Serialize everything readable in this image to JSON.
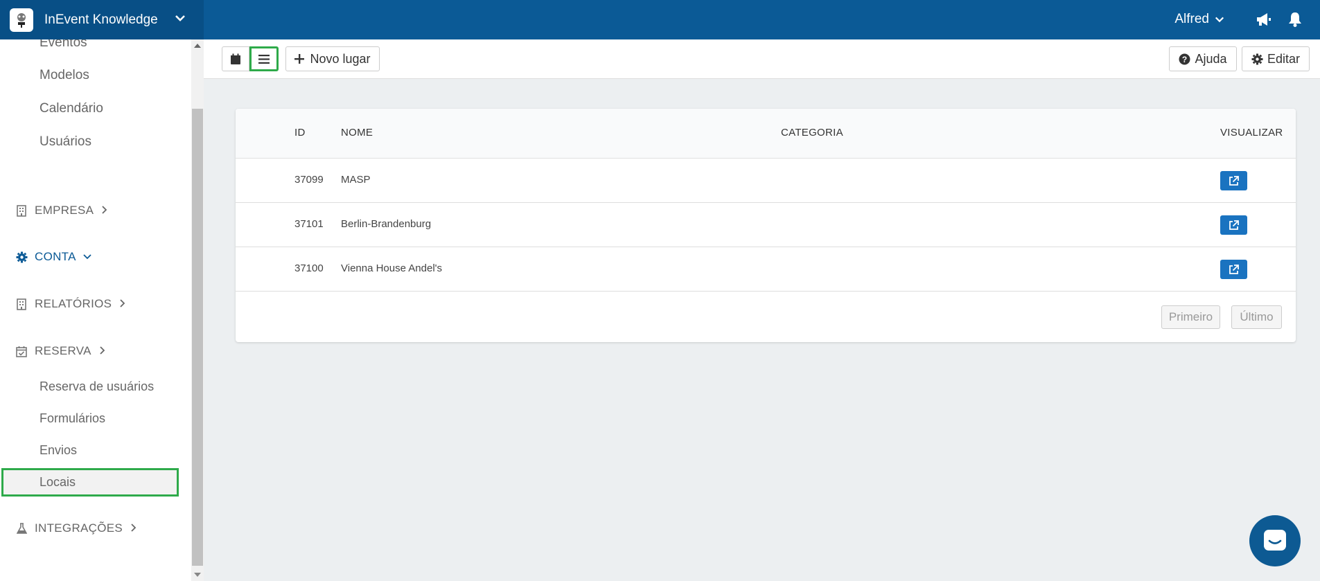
{
  "header": {
    "app_title": "InEvent Knowledge",
    "user_name": "Alfred",
    "icons": [
      "app-logo",
      "chevron-down-icon",
      "megaphone-icon",
      "bell-icon"
    ]
  },
  "sidebar": {
    "top_items": [
      "Eventos",
      "Modelos",
      "Calendário",
      "Usuários"
    ],
    "sections": {
      "empresa": "EMPRESA",
      "conta": "CONTA",
      "relatorios": "RELATÓRIOS",
      "reserva": "RESERVA",
      "integracoes": "INTEGRAÇÕES"
    },
    "reserva_items": [
      "Reserva de usuários",
      "Formulários",
      "Envios",
      "Locais"
    ],
    "active_item": "Locais"
  },
  "toolbar": {
    "new_place_label": "Novo lugar",
    "help_label": "Ajuda",
    "edit_label": "Editar"
  },
  "table": {
    "columns": [
      "ID",
      "NOME",
      "CATEGORIA",
      "VISUALIZAR"
    ],
    "rows": [
      {
        "id": "37099",
        "name": "MASP",
        "category": ""
      },
      {
        "id": "37101",
        "name": "Berlin-Brandenburg",
        "category": ""
      },
      {
        "id": "37100",
        "name": "Vienna House Andel's",
        "category": ""
      }
    ],
    "pagination": {
      "first": "Primeiro",
      "last": "Último"
    }
  },
  "colors": {
    "header_bg": "#0b5a96",
    "accent": "#1a73c0",
    "highlight": "#2eaa4a"
  }
}
